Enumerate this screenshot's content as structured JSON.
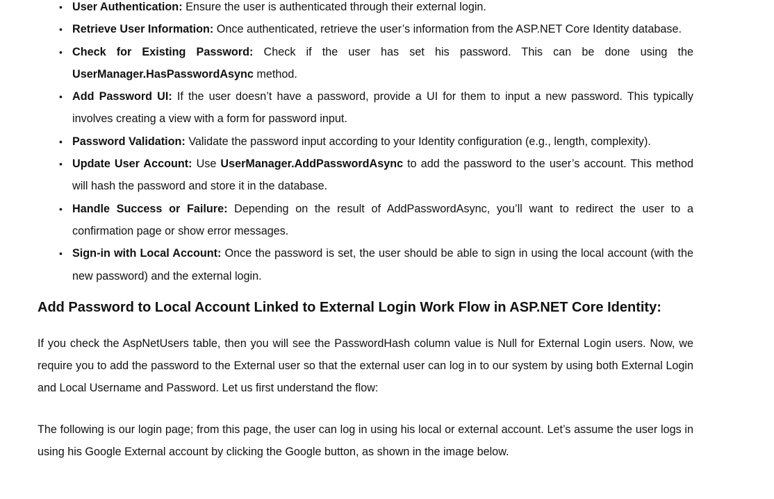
{
  "steps": [
    {
      "bold": "User Authentication:",
      "text": " Ensure the user is authenticated through their external login."
    },
    {
      "bold": "Retrieve User Information:",
      "text": " Once authenticated, retrieve the user’s information from the ASP.NET Core Identity database."
    },
    {
      "bold": "Check for Existing Password:",
      "text": " Check if the user has set his password. This can be done using the ",
      "code": "UserManager.HasPasswordAsync",
      "after": " method."
    },
    {
      "bold": "Add Password UI:",
      "text": " If the user doesn’t have a password, provide a UI for them to input a new password. This typically involves creating a view with a form for password input."
    },
    {
      "bold": "Password Validation:",
      "text": " Validate the password input according to your Identity configuration (e.g., length, complexity)."
    },
    {
      "bold": "Update User Account:",
      "text": " Use ",
      "code": "UserManager.AddPasswordAsync",
      "after": " to add the password to the user’s account. This method will hash the password and store it in the database."
    },
    {
      "bold": "Handle Success or Failure:",
      "text": " Depending on the result of AddPasswordAsync, you’ll want to redirect the user to a confirmation page or show error messages."
    },
    {
      "bold": "Sign-in with Local Account:",
      "text": " Once the password is set, the user should be able to sign in using the local account (with the new password) and the external login."
    }
  ],
  "bullet_char": "•",
  "heading": "Add Password to Local Account Linked to External Login Work Flow in ASP.NET Core Identity:",
  "paragraphs": [
    "If you check the AspNetUsers table, then you will see the PasswordHash column value is Null for External Login users. Now, we require you to add the password to the External user so that the external user can log in to our system by using both External Login and Local Username and Password. Let us first understand the flow:",
    "The following is our login page; from this page, the user can log in using his local or external account. Let’s assume the user logs in using his Google External account by clicking the Google button, as shown in the image below."
  ]
}
